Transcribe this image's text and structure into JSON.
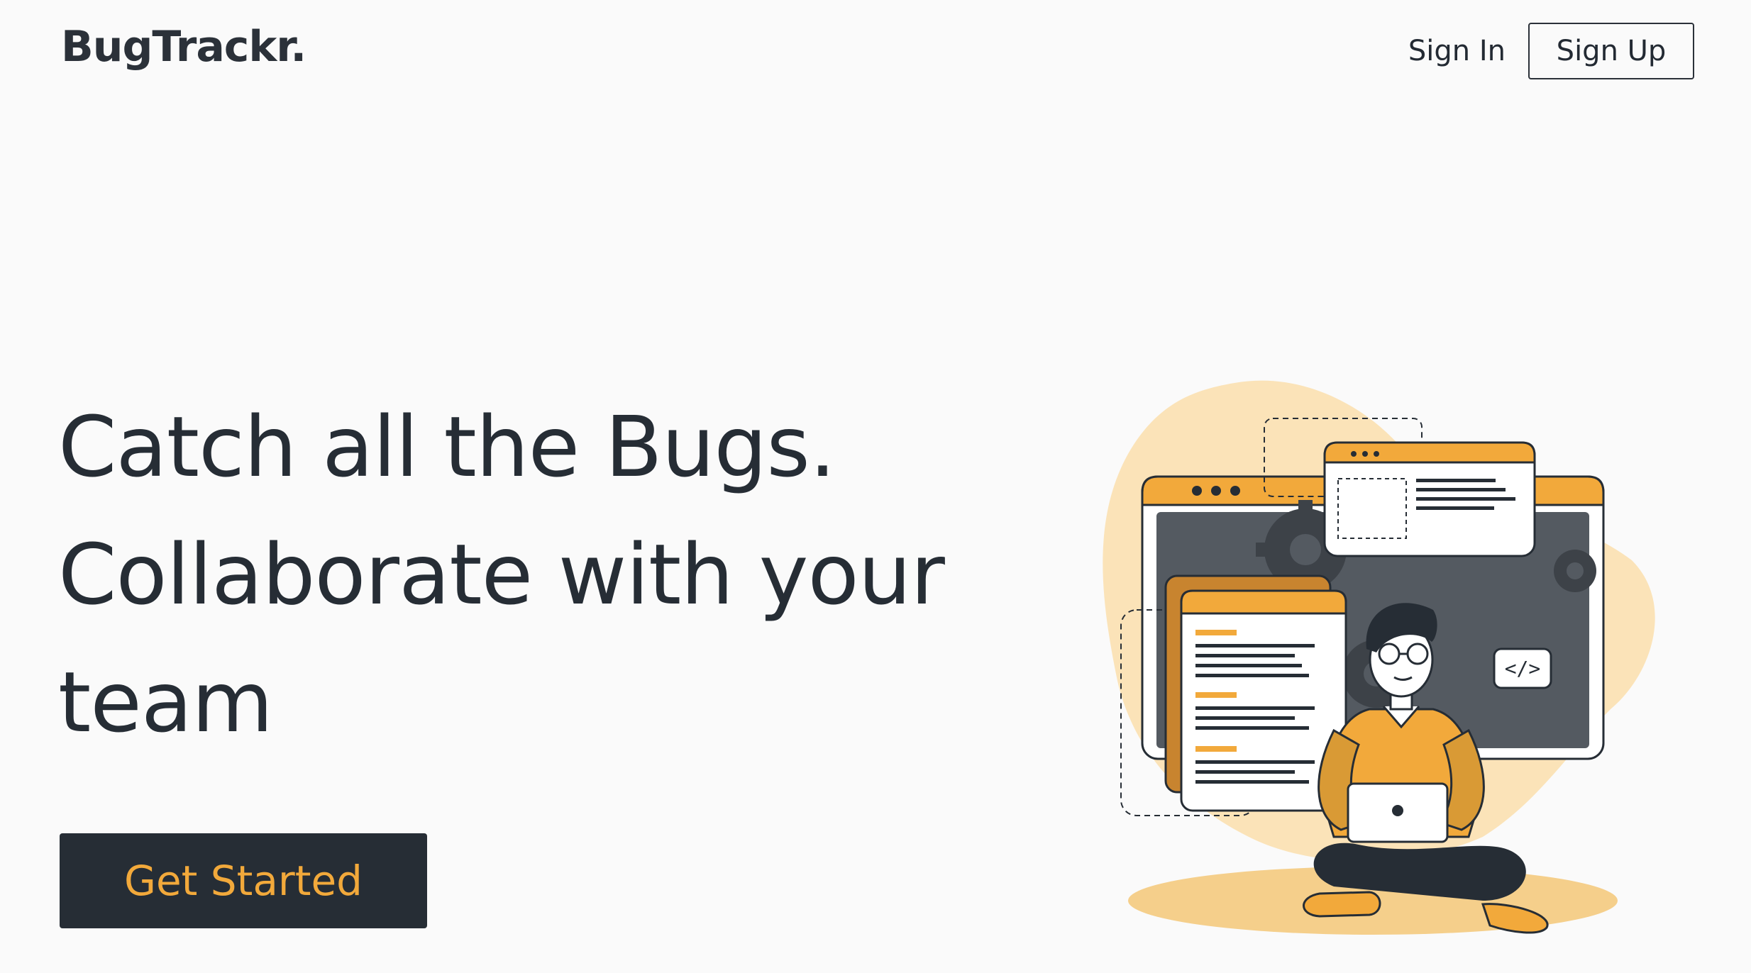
{
  "header": {
    "brand": "BugTrackr.",
    "sign_in": "Sign In",
    "sign_up": "Sign Up"
  },
  "hero": {
    "lines": [
      "Catch all the Bugs.",
      "Collaborate with your",
      "team"
    ],
    "cta": "Get Started"
  },
  "illustration": {
    "code_tag": "</>"
  },
  "colors": {
    "accent": "#f2a93b",
    "dark": "#262d35",
    "background": "#fafafa",
    "blob": "#fbe3b8"
  },
  "icons": [
    "gear-icon",
    "code-tag-icon",
    "laptop-icon"
  ]
}
